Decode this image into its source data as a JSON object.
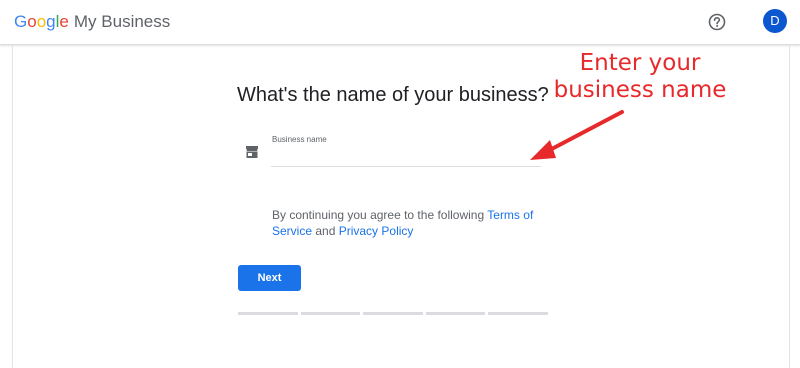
{
  "header": {
    "logo_letters": [
      "G",
      "o",
      "o",
      "g",
      "l",
      "e"
    ],
    "product_name": "My Business",
    "help_icon": "help-circle-icon",
    "avatar_initial": "D",
    "avatar_color": "#0b57d0"
  },
  "main": {
    "heading": "What's the name of your business?",
    "field": {
      "icon": "store-icon",
      "label": "Business name",
      "value": ""
    },
    "consent": {
      "prefix": "By continuing you agree to the following ",
      "terms_link": "Terms of Service",
      "middle": " and ",
      "privacy_link": "Privacy Policy"
    },
    "next_button": "Next",
    "progress_steps": 5
  },
  "annotation": {
    "line1": "Enter your",
    "line2": "business name",
    "color": "#e8292b"
  },
  "colors": {
    "accent": "#1a73e8",
    "link": "#1a73e8",
    "divider": "#dadce0"
  }
}
